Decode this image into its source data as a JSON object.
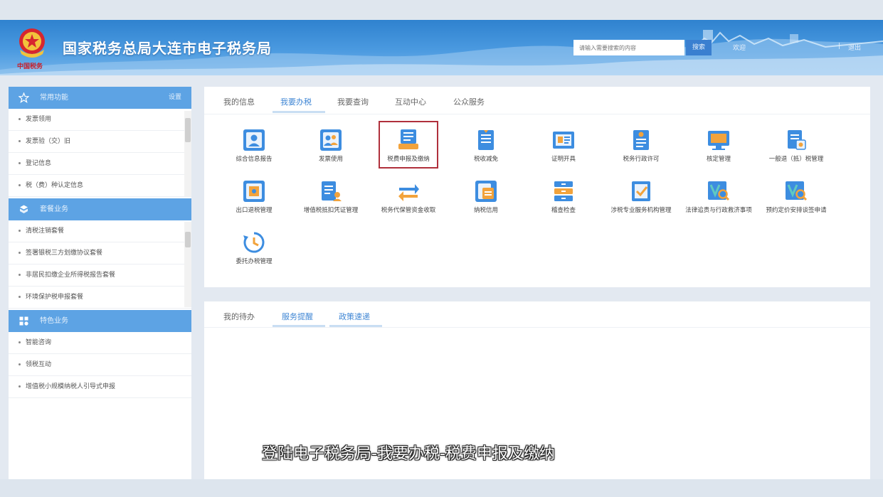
{
  "header": {
    "title": "国家税务总局大连市电子税务局",
    "emblem_text": "中国税务",
    "search_placeholder": "请输入需要搜索的内容",
    "search_button": "搜索",
    "user_link": "欢迎",
    "logout_link": "退出",
    "divider": "|"
  },
  "sidebar": {
    "groups": [
      {
        "title": "常用功能",
        "icon": "star-icon",
        "settings": "设置",
        "items": [
          "发票领用",
          "发票验（交）旧",
          "登记信息",
          "税（费）种认定信息"
        ]
      },
      {
        "title": "套餐业务",
        "icon": "package-icon",
        "items": [
          "清税注销套餐",
          "签署银税三方划缴协议套餐",
          "非居民扣缴企业所得税报告套餐",
          "环境保护税申报套餐"
        ]
      },
      {
        "title": "特色业务",
        "icon": "feature-icon",
        "items": [
          "智能咨询",
          "领税互动",
          "增值税小规模纳税人引导式申报"
        ]
      }
    ]
  },
  "main_tabs": [
    "我的信息",
    "我要办税",
    "我要查询",
    "互动中心",
    "公众服务"
  ],
  "active_tab": "我要办税",
  "tiles": [
    {
      "label": "综合信息报告",
      "icon": "person-card-icon"
    },
    {
      "label": "发票使用",
      "icon": "users-icon"
    },
    {
      "label": "税费申报及缴纳",
      "icon": "declaration-icon"
    },
    {
      "label": "税收减免",
      "icon": "document-icon"
    },
    {
      "label": "证明开具",
      "icon": "certificate-icon"
    },
    {
      "label": "税务行政许可",
      "icon": "license-icon"
    },
    {
      "label": "核定管理",
      "icon": "monitor-icon"
    },
    {
      "label": "一般退（抵）税管理",
      "icon": "refund-icon"
    },
    {
      "label": "出口退税管理",
      "icon": "export-icon"
    },
    {
      "label": "增值税抵扣凭证管理",
      "icon": "voucher-icon"
    },
    {
      "label": "税务代保管资金收取",
      "icon": "transfer-icon"
    },
    {
      "label": "纳税信用",
      "icon": "credit-icon"
    },
    {
      "label": "稽查检查",
      "icon": "cabinet-icon"
    },
    {
      "label": "涉税专业服务机构管理",
      "icon": "shield-check-icon"
    },
    {
      "label": "法律追责与行政救济事项",
      "icon": "law-search-icon"
    },
    {
      "label": "预约定价安排谈签申请",
      "icon": "pricing-search-icon"
    },
    {
      "label": "委托办税管理",
      "icon": "clock-icon"
    }
  ],
  "highlighted_tile": "税费申报及缴纳",
  "lower_tabs": [
    "我的待办",
    "服务提醒",
    "政策速递"
  ],
  "subtitle": "登陆电子税务局-我要办税-税费申报及缴纳",
  "colors": {
    "header_blue": "#2f82cf",
    "sidebar_head": "#5da3e4",
    "active_tab": "#3f86d4",
    "highlight_border": "#b0303c"
  }
}
